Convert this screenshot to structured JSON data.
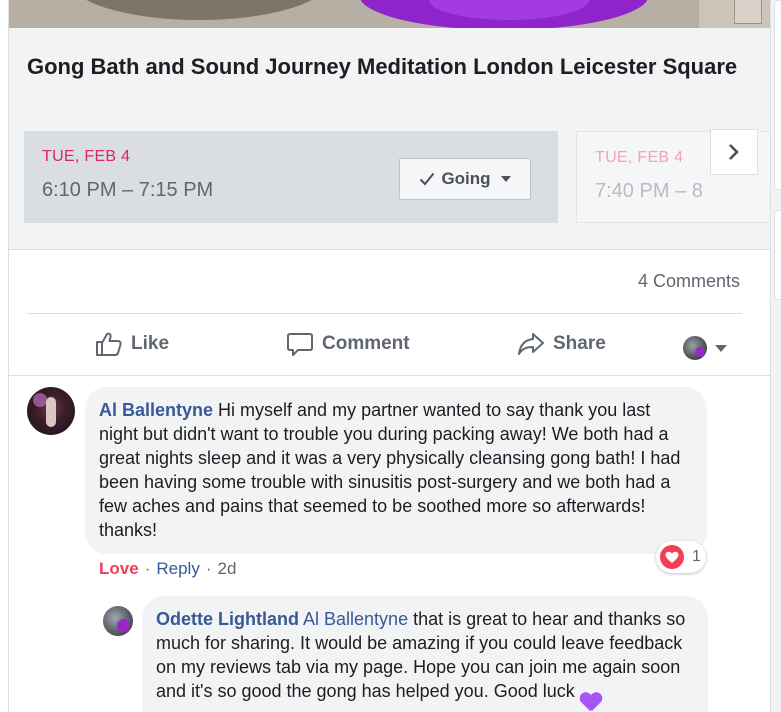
{
  "event": {
    "title": "Gong Bath and Sound Journey Meditation London Leicester Square",
    "slots": [
      {
        "date": "TUE, FEB 4",
        "time": "6:10 PM – 7:15 PM",
        "rsvp": "Going"
      },
      {
        "date": "TUE, FEB 4",
        "time": "7:40 PM – 8"
      }
    ],
    "next_icon": "chevron-right-icon"
  },
  "stats": {
    "comments": "4 Comments"
  },
  "actions": {
    "like": "Like",
    "comment": "Comment",
    "share": "Share"
  },
  "comments": [
    {
      "author": "Al Ballentyne",
      "text": " Hi myself and my partner wanted to say thank you last night but didn't want to trouble you during packing away! We both had a great nights sleep and it was a very physically cleansing gong bath! I had been having some trouble with sinusitis post-surgery and we both had a few aches and pains that seemed to be soothed more so afterwards! thanks!",
      "reaction_count": "1",
      "reaction_type": "love",
      "love_label": "Love",
      "sep1": "·",
      "reply_label": "Reply",
      "sep2": "·",
      "time": "2d"
    },
    {
      "author": "Odette Lightland",
      "mention": "Al Ballentyne",
      "text": " that is great to hear and thanks so much for sharing. It would be amazing if you could leave feedback on my reviews tab via my page. Hope you can join me again soon and it's so good the gong has helped you.",
      "text_tail": "Good luck ",
      "emoji": "purple-heart-icon"
    }
  ],
  "colors": {
    "link": "#385898",
    "date_red": "#e0245e",
    "love_red": "#f33e58",
    "muted": "#606770"
  }
}
